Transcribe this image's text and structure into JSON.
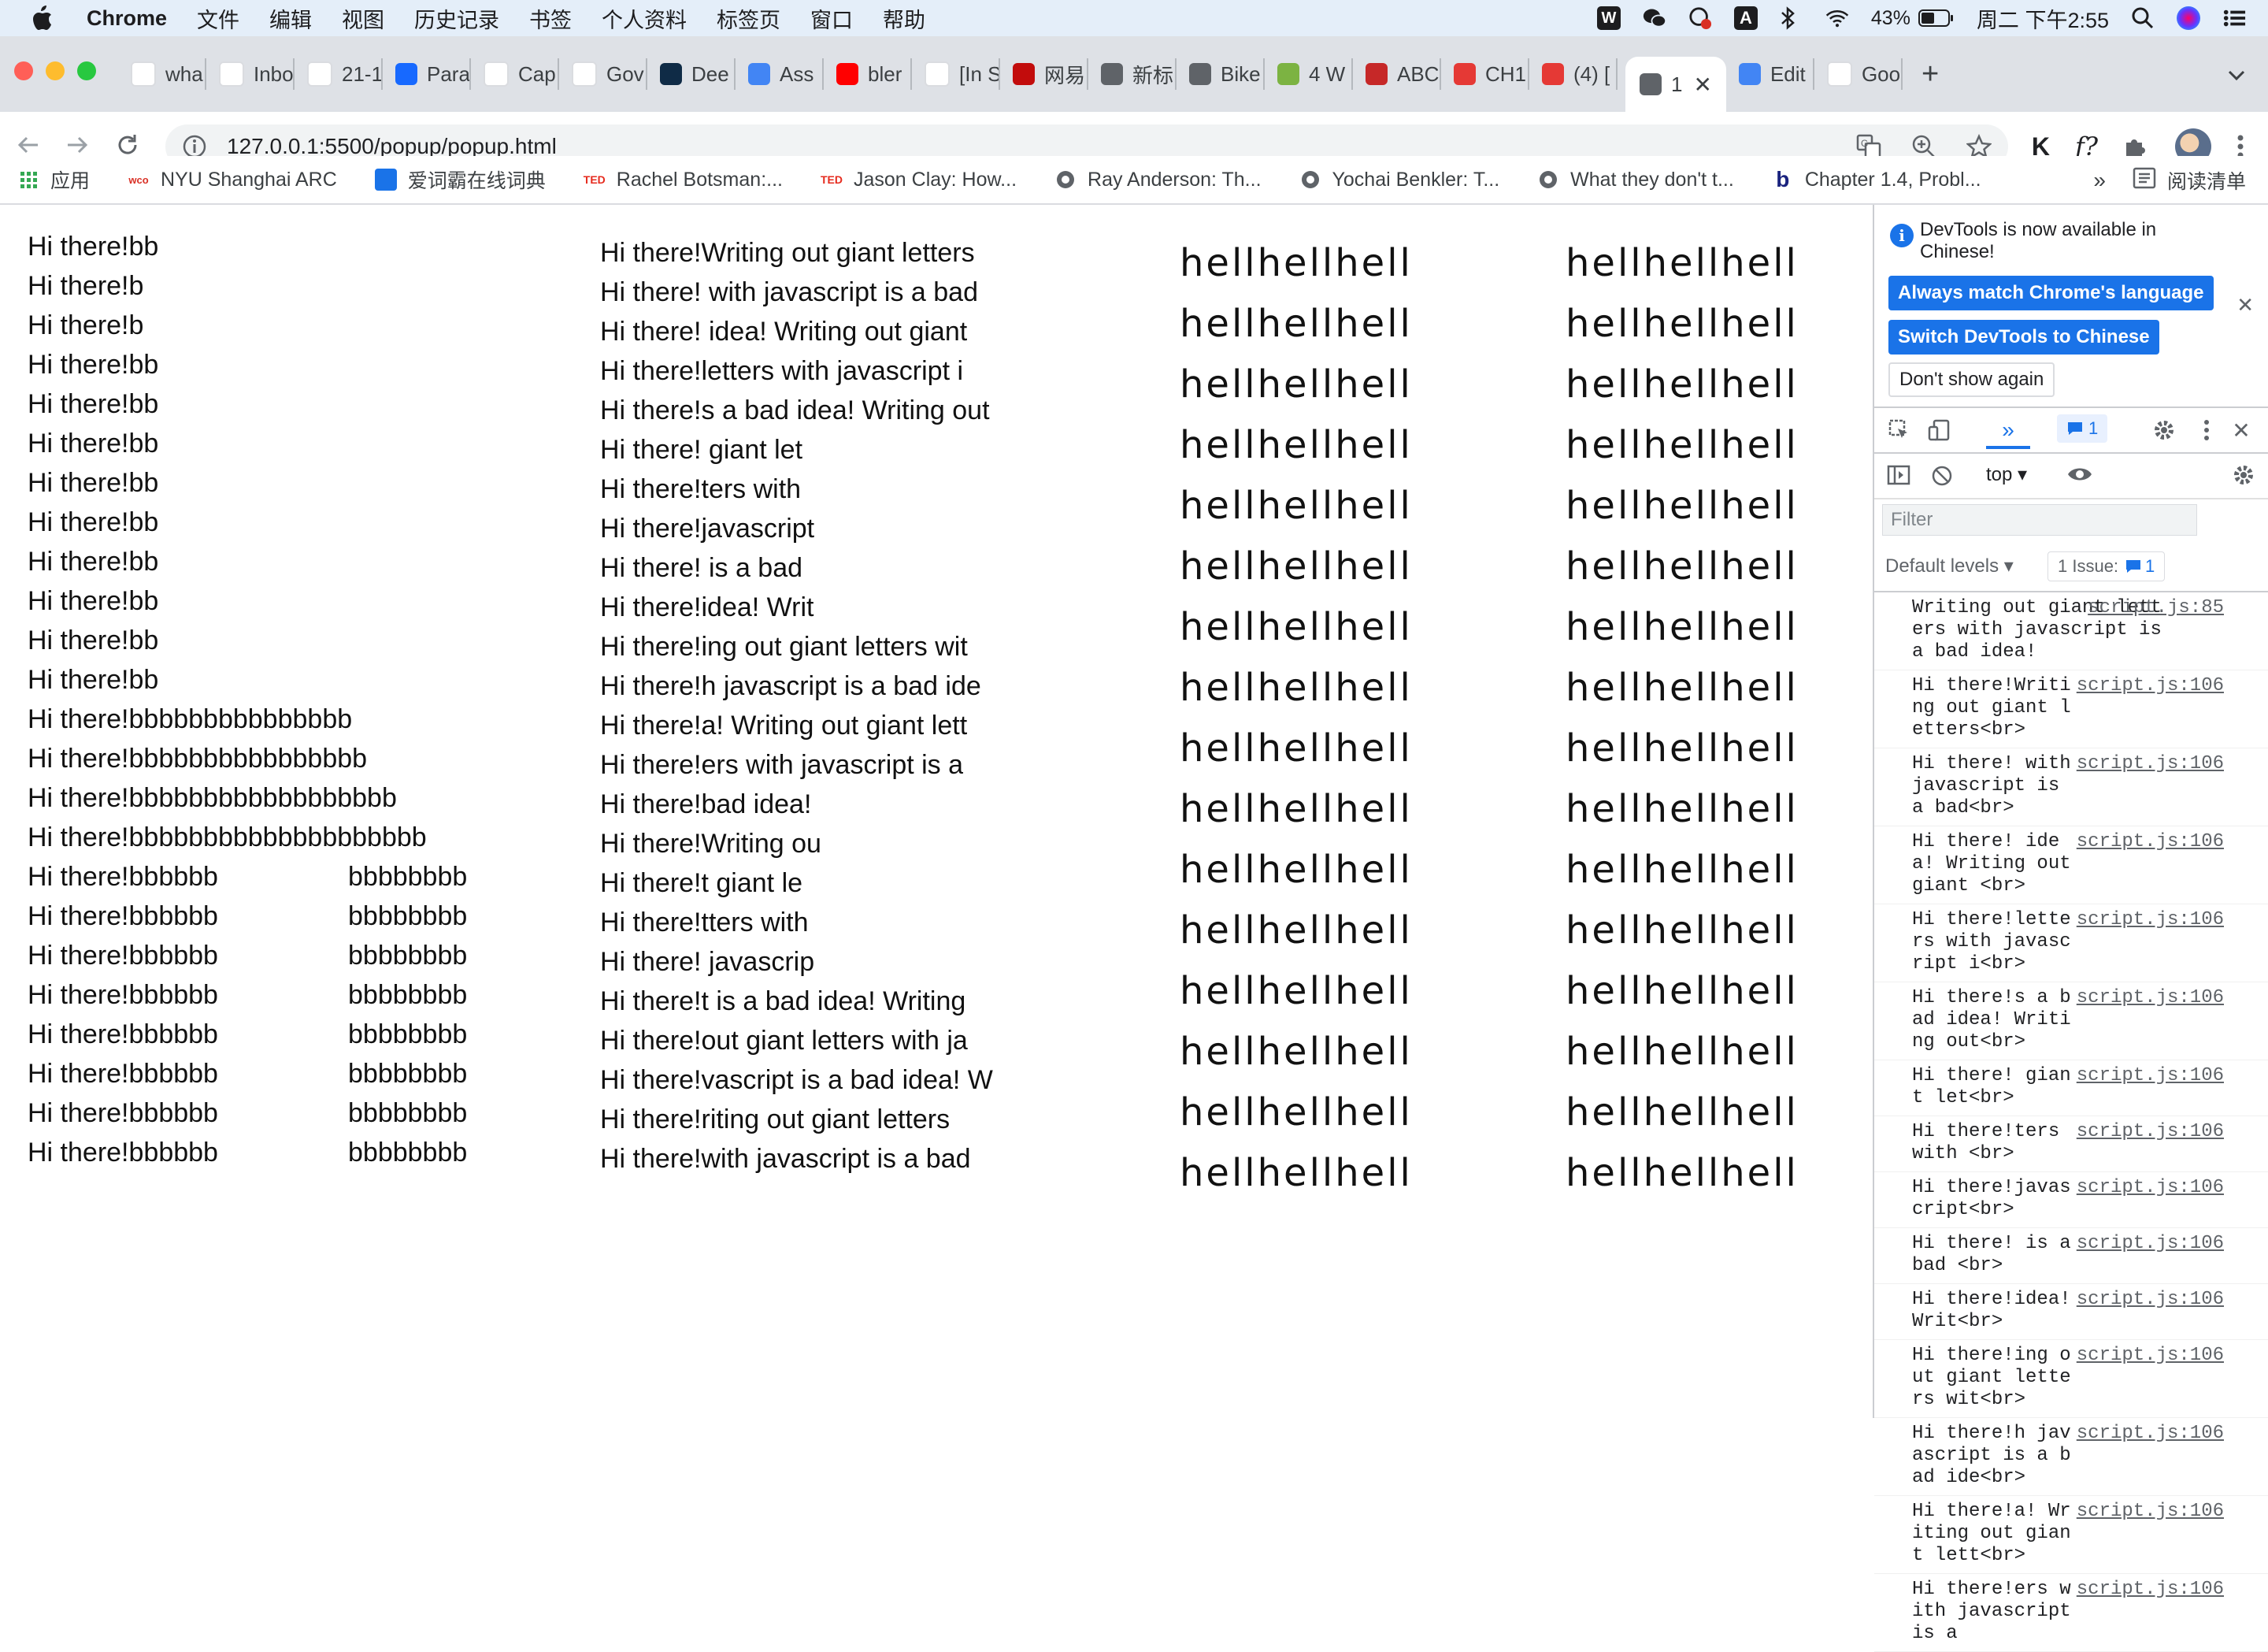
{
  "menubar": {
    "app_name": "Chrome",
    "menus": [
      "文件",
      "编辑",
      "视图",
      "历史记录",
      "书签",
      "个人资料",
      "标签页",
      "窗口",
      "帮助"
    ],
    "battery": "43%",
    "clock": "周二 下午2:55"
  },
  "tabs": [
    {
      "title": "wha",
      "icon": "google-icon",
      "color": "#ffffff"
    },
    {
      "title": "Inbo",
      "icon": "gmail-icon",
      "color": "#ffffff"
    },
    {
      "title": "21-1",
      "icon": "drive-icon",
      "color": "#ffffff"
    },
    {
      "title": "Para",
      "icon": "behance-icon",
      "color": "#1769ff"
    },
    {
      "title": "Cap",
      "icon": "gmail-icon",
      "color": "#ffffff"
    },
    {
      "title": "Gov",
      "icon": "colab-icon",
      "color": "#ffffff"
    },
    {
      "title": "Dee",
      "icon": "deepl-icon",
      "color": "#0f2b46"
    },
    {
      "title": "Ass",
      "icon": "docs-icon",
      "color": "#4285f4"
    },
    {
      "title": "bler",
      "icon": "youtube-icon",
      "color": "#ff0000"
    },
    {
      "title": "[In S",
      "icon": "gmail-icon",
      "color": "#ffffff"
    },
    {
      "title": "网易",
      "icon": "netease-icon",
      "color": "#c20c0c"
    },
    {
      "title": "新标",
      "icon": "chrome-icon",
      "color": "#5f6368"
    },
    {
      "title": "Bike",
      "icon": "globe-icon",
      "color": "#5f6368"
    },
    {
      "title": "4 W",
      "icon": "wiki-icon",
      "color": "#7cb342"
    },
    {
      "title": "ABC",
      "icon": "abc-icon",
      "color": "#c62828"
    },
    {
      "title": "CH1",
      "icon": "hundred-icon",
      "color": "#e53935"
    },
    {
      "title": "(4) [",
      "icon": "c-icon",
      "color": "#e53935"
    },
    {
      "title": "1",
      "icon": "globe-icon",
      "color": "#5f6368",
      "active": true
    },
    {
      "title": "Edit",
      "icon": "cloud-icon",
      "color": "#4285f4"
    },
    {
      "title": "Goo",
      "icon": "google-icon",
      "color": "#ffffff"
    }
  ],
  "address": {
    "url": "127.0.0.1:5500/popup/popup.html"
  },
  "bookmarks": [
    {
      "label": "应用",
      "icon": "apps-grid-icon"
    },
    {
      "label": "NYU Shanghai ARC",
      "icon": "wco-icon"
    },
    {
      "label": "爱词霸在线词典",
      "icon": "iciba-icon"
    },
    {
      "label": "Rachel Botsman:...",
      "icon": "ted-icon"
    },
    {
      "label": "Jason Clay: How...",
      "icon": "ted-icon"
    },
    {
      "label": "Ray Anderson: Th...",
      "icon": "globe-icon"
    },
    {
      "label": "Yochai Benkler: T...",
      "icon": "globe-icon"
    },
    {
      "label": "What they don't t...",
      "icon": "globe-icon"
    },
    {
      "label": "Chapter 1.4, Probl...",
      "icon": "bbc-b-icon"
    }
  ],
  "reading_list": "阅读清单",
  "content": {
    "col_a": [
      "Hi there!bb",
      "Hi there!b",
      "Hi there!b",
      "Hi there!bb",
      "Hi there!bb",
      "Hi there!bb",
      "Hi there!bb",
      "Hi there!bb",
      "Hi there!bb",
      "Hi there!bb",
      "Hi there!bb",
      "Hi there!bb",
      "Hi there!bbbbbbbbbbbbbbb",
      "Hi there!bbbbbbbbbbbbbbbb",
      "Hi there!bbbbbbbbbbbbbbbbbb",
      "Hi there!bbbbbbbbbbbbbbbbbbbb"
    ],
    "col_a_pairs": [
      [
        "Hi there!bbbbbb",
        "bbbbbbbb"
      ],
      [
        "Hi there!bbbbbb",
        "bbbbbbbb"
      ],
      [
        "Hi there!bbbbbb",
        "bbbbbbbb"
      ],
      [
        "Hi there!bbbbbb",
        "bbbbbbbb"
      ],
      [
        "Hi there!bbbbbb",
        "bbbbbbbb"
      ],
      [
        "Hi there!bbbbbb",
        "bbbbbbbb"
      ],
      [
        "Hi there!bbbbbb",
        "bbbbbbbb"
      ],
      [
        "Hi there!bbbbbb",
        "bbbbbbbb"
      ]
    ],
    "col_b": [
      "Hi there!Writing out giant letters",
      "Hi there! with javascript is a bad",
      "Hi there! idea! Writing out giant",
      "Hi there!letters with javascript i",
      "Hi there!s a bad idea! Writing out",
      "Hi there! giant let",
      "Hi there!ters with",
      "Hi there!javascript",
      "Hi there! is a bad",
      "Hi there!idea! Writ",
      "Hi there!ing out giant letters wit",
      "Hi there!h javascript is a bad ide",
      "Hi there!a! Writing out giant lett",
      "Hi there!ers with javascript is a",
      "Hi there!bad idea!",
      "Hi there!Writing ou",
      "Hi there!t giant le",
      "Hi there!tters with",
      "Hi there! javascrip",
      "Hi there!t is a bad idea! Writing",
      "Hi there!out giant letters with ja",
      "Hi there!vascript is a bad idea! W",
      "Hi there!riting out giant letters",
      "Hi there!with javascript is a bad"
    ],
    "giant_word": "hellhellhell",
    "giant_rows": 16
  },
  "devtools": {
    "banner_msg": "DevTools is now available in Chinese!",
    "btn_match": "Always match Chrome's language",
    "btn_switch": "Switch DevTools to Chinese",
    "btn_dont": "Don't show again",
    "messages_count": "1",
    "context": "top",
    "filter_placeholder": "Filter",
    "levels": "Default levels",
    "issues_label": "1 Issue:",
    "issues_count": "1",
    "logs": [
      {
        "msg": "Writing out giant letters with javascript is a bad idea!",
        "src": "script.js:85",
        "wide": true
      },
      {
        "msg": "Hi there!Writing out giant letters<br>",
        "src": "script.js:106"
      },
      {
        "msg": "Hi there! with javascript is a bad<br>",
        "src": "script.js:106"
      },
      {
        "msg": "Hi there! idea! Writing out giant <br>",
        "src": "script.js:106"
      },
      {
        "msg": "Hi there!letters with javascript i<br>",
        "src": "script.js:106"
      },
      {
        "msg": "Hi there!s a bad idea! Writing out<br>",
        "src": "script.js:106"
      },
      {
        "msg": "Hi there! giant let<br>",
        "src": "script.js:106"
      },
      {
        "msg": "Hi there!ters with <br>",
        "src": "script.js:106"
      },
      {
        "msg": "Hi there!javascript<br>",
        "src": "script.js:106"
      },
      {
        "msg": "Hi there! is a bad <br>",
        "src": "script.js:106"
      },
      {
        "msg": "Hi there!idea! Writ<br>",
        "src": "script.js:106"
      },
      {
        "msg": "Hi there!ing out giant letters wit<br>",
        "src": "script.js:106"
      },
      {
        "msg": "Hi there!h javascript is a bad ide<br>",
        "src": "script.js:106"
      },
      {
        "msg": "Hi there!a! Writing out giant lett<br>",
        "src": "script.js:106"
      },
      {
        "msg": "Hi there!ers with javascript is a",
        "src": "script.js:106"
      }
    ]
  }
}
